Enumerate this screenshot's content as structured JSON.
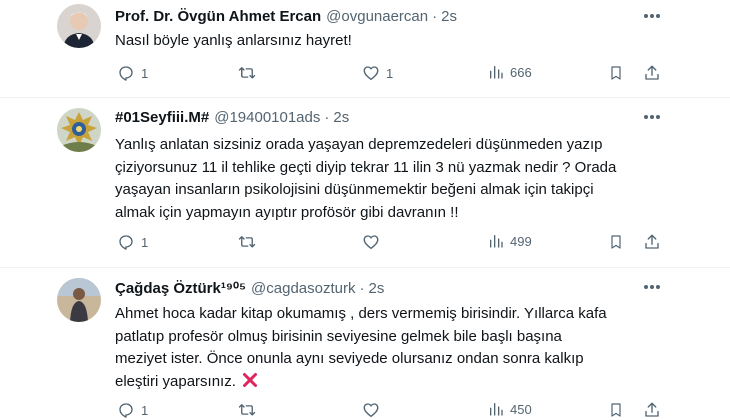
{
  "tweets": [
    {
      "name": "Prof. Dr. Övgün Ahmet Ercan",
      "handle": "@ovgunaercan",
      "separator": "·",
      "time": "2s",
      "lines": [
        "Nasıl böyle yanlış anlarsınız hayret!"
      ],
      "counts": {
        "reply": "1",
        "retweet": "",
        "like": "1",
        "views": "666"
      }
    },
    {
      "name": "#01Seyfiii.M#",
      "handle": "@19400101ads",
      "separator": "·",
      "time": "2s",
      "lines": [
        "Yanlış anlatan sizsiniz orada yaşayan depremzedeleri düşünmeden yazıp",
        "çiziyorsunuz 11 il tehlike geçti diyip tekrar 11 ilin 3 nü yazmak nedir ? Orada",
        "yaşayan insanların psikolojisini düşünmemektir beğeni almak için takipçi",
        "almak için yapmayın ayıptır profösör gibi davranın !!"
      ],
      "counts": {
        "reply": "1",
        "retweet": "",
        "like": "",
        "views": "499"
      }
    },
    {
      "name": "Çağdaş Öztürk¹⁹⁰⁵",
      "handle": "@cagdasozturk",
      "separator": "·",
      "time": "2s",
      "lines": [
        "Ahmet hoca kadar kitap okumamış , ders vermemiş birisindir. Yıllarca kafa",
        "patlatıp profesör olmuş birisinin seviyesine gelmek bile başlı başına",
        "meziyet ister. Önce onunla aynı seviyede olursanız ondan sonra kalkıp",
        "eleştiri yaparsınız."
      ],
      "counts": {
        "reply": "1",
        "retweet": "",
        "like": "",
        "views": "450"
      }
    }
  ],
  "icons": {
    "reply": "reply-icon",
    "retweet": "retweet-icon",
    "like": "heart-icon",
    "views": "views-icon",
    "bookmark": "bookmark-icon",
    "share": "share-icon",
    "more": "more-icon",
    "cross": "cross-mark-emoji"
  },
  "colors": {
    "text": "#0f1419",
    "secondary": "#536471",
    "cross": "#e0245e"
  }
}
